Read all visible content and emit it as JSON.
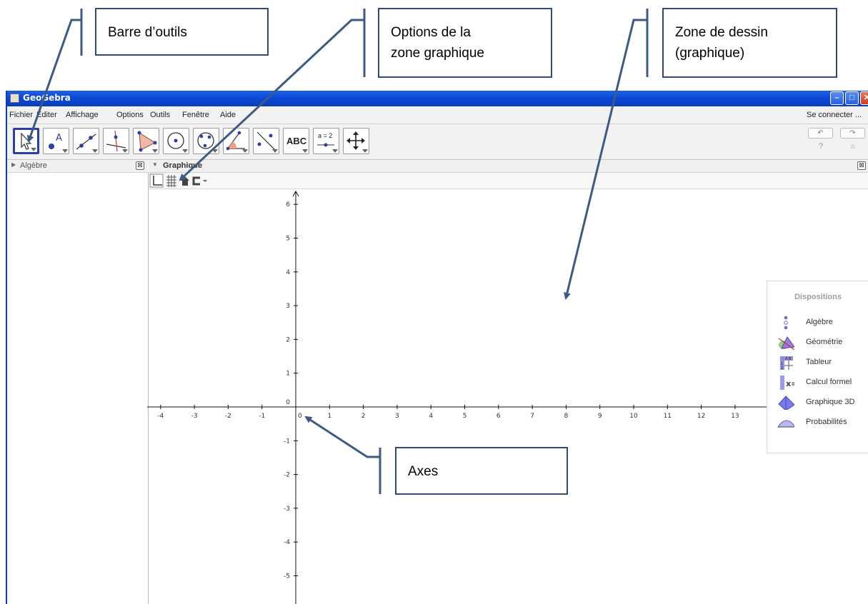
{
  "window": {
    "title": "GeoGebra",
    "controls": [
      "–",
      "□",
      "✕"
    ]
  },
  "menu": {
    "items": [
      "Fichier",
      "Éditer",
      "Affichage",
      "Options",
      "Outils",
      "Fenêtre",
      "Aide"
    ],
    "signin": "Se connecter ..."
  },
  "toolbar": {
    "tools": [
      {
        "icon": "move-arrow-icon",
        "selected": true
      },
      {
        "icon": "point-icon"
      },
      {
        "icon": "line-icon"
      },
      {
        "icon": "perpendicular-line-icon"
      },
      {
        "icon": "polygon-icon"
      },
      {
        "icon": "circle-center-point-icon"
      },
      {
        "icon": "circle-three-points-icon"
      },
      {
        "icon": "angle-icon"
      },
      {
        "icon": "reflect-icon"
      },
      {
        "icon": "text-icon",
        "label": "ABC"
      },
      {
        "icon": "slider-icon",
        "label": "a = 2"
      },
      {
        "icon": "move-graphics-icon"
      }
    ],
    "undo": "↶",
    "redo": "↷",
    "help": "?",
    "settings": "☼"
  },
  "algebra_panel": {
    "title": "Algèbre",
    "close": "⊠"
  },
  "graphics_panel": {
    "title": "Graphique",
    "close": "⊠"
  },
  "style_bar": {
    "icons": [
      "axes-toggle-icon",
      "grid-toggle-icon",
      "home-icon",
      "point-capture-icon"
    ]
  },
  "axes": {
    "x_ticks": [
      "-4",
      "-3",
      "-2",
      "-1",
      "0",
      "1",
      "2",
      "3",
      "4",
      "5",
      "6",
      "7",
      "8",
      "9",
      "10",
      "11",
      "12",
      "13"
    ],
    "y_ticks": [
      "6",
      "5",
      "4",
      "3",
      "2",
      "1",
      "0",
      "-1",
      "-2",
      "-3",
      "-4",
      "-5"
    ]
  },
  "dispositions": {
    "title": "Dispositions",
    "items": [
      {
        "label": "Algèbre",
        "icon": "algebra-perspective-icon"
      },
      {
        "label": "Géométrie",
        "icon": "geometry-perspective-icon"
      },
      {
        "label": "Tableur",
        "icon": "spreadsheet-perspective-icon"
      },
      {
        "label": "Calcul formel",
        "icon": "cas-perspective-icon"
      },
      {
        "label": "Graphique 3D",
        "icon": "graphics-3d-perspective-icon"
      },
      {
        "label": "Probabilités",
        "icon": "probability-perspective-icon"
      }
    ]
  },
  "callouts": {
    "toolbar": "Barre d’outils",
    "options": "Options de la\nzone graphique",
    "drawing": "Zone de dessin\n(graphique)",
    "axes": "Axes"
  },
  "colors": {
    "titlebar": "#0b49d6",
    "callout_border": "#2e4a7a",
    "selected_tool": "#2a3ea6"
  }
}
